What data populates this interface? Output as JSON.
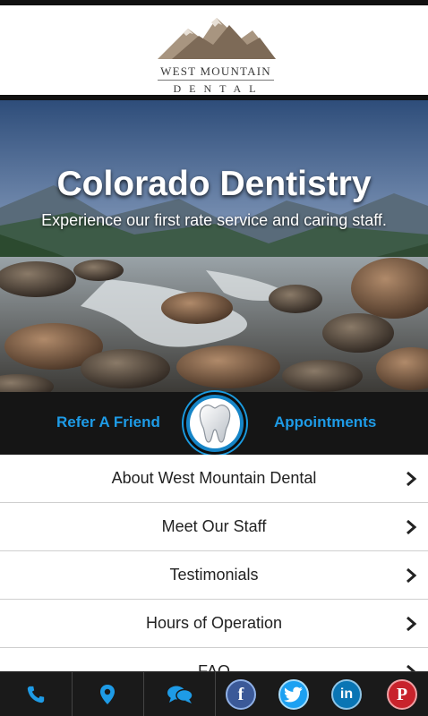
{
  "brand": {
    "name_line1": "WEST MOUNTAIN",
    "name_line2": "DENTAL"
  },
  "hero": {
    "title": "Colorado Dentistry",
    "subtitle": "Experience our first rate service and caring staff."
  },
  "actions": {
    "refer": "Refer A Friend",
    "appointments": "Appointments",
    "center_icon": "tooth-icon"
  },
  "menu": {
    "items": [
      {
        "label": "About West Mountain Dental"
      },
      {
        "label": "Meet Our Staff"
      },
      {
        "label": "Testimonials"
      },
      {
        "label": "Hours of Operation"
      },
      {
        "label": "FAQ"
      }
    ]
  },
  "bottom_nav": {
    "icons": [
      "phone-icon",
      "location-pin-icon",
      "chat-icon",
      "facebook-icon",
      "twitter-icon",
      "linkedin-icon",
      "pinterest-icon"
    ],
    "social": {
      "facebook": "f",
      "linkedin": "in",
      "pinterest": "P"
    }
  },
  "colors": {
    "accent": "#1e9be6",
    "dark": "#151515",
    "facebook": "#3b5998",
    "twitter": "#1da1f2",
    "linkedin": "#0a75b4",
    "pinterest": "#c8232c"
  }
}
